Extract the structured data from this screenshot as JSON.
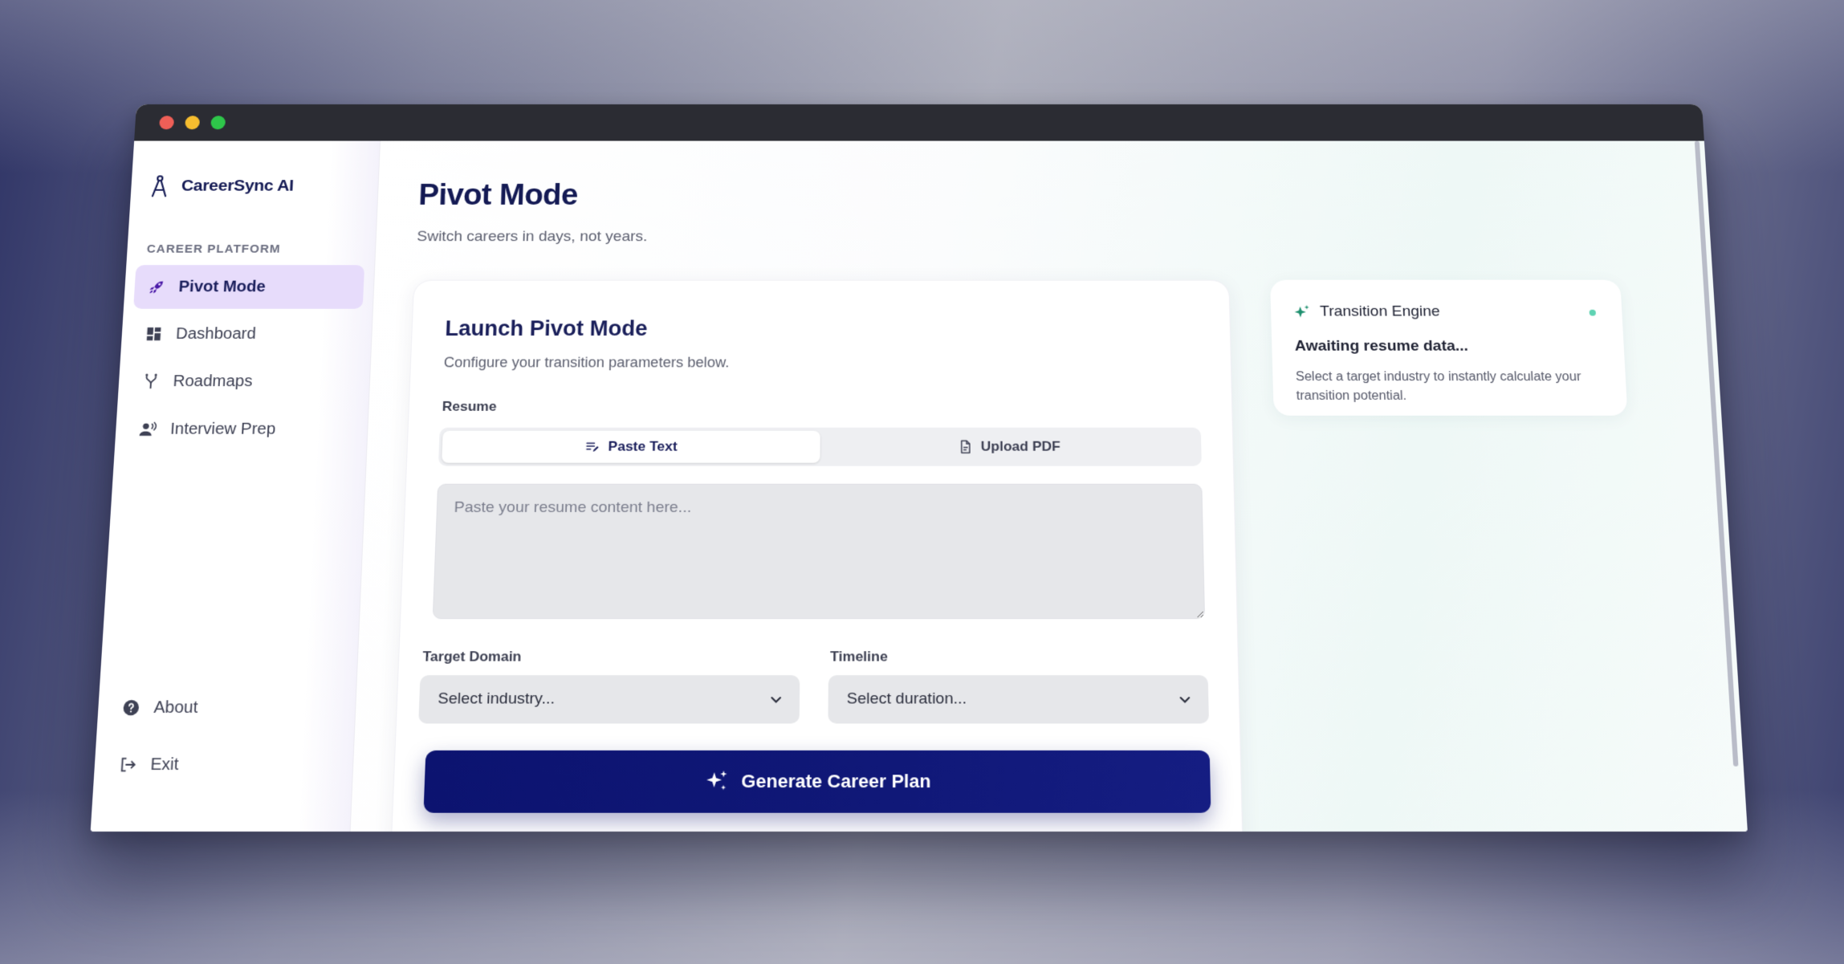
{
  "app": {
    "name": "CareerSync AI",
    "section_label": "CAREER PLATFORM"
  },
  "sidebar": {
    "items": [
      {
        "label": "Pivot Mode",
        "icon": "rocket-icon",
        "active": true
      },
      {
        "label": "Dashboard",
        "icon": "dashboard-icon",
        "active": false
      },
      {
        "label": "Roadmaps",
        "icon": "fork-icon",
        "active": false
      },
      {
        "label": "Interview Prep",
        "icon": "speaking-person-icon",
        "active": false
      }
    ],
    "bottom_items": [
      {
        "label": "About",
        "icon": "help-circle-icon"
      },
      {
        "label": "Exit",
        "icon": "logout-icon"
      }
    ]
  },
  "page": {
    "title": "Pivot Mode",
    "subtitle": "Switch careers in days, not years."
  },
  "form": {
    "title": "Launch Pivot Mode",
    "subtitle": "Configure your transition parameters below.",
    "resume_label": "Resume",
    "tabs": [
      {
        "label": "Paste Text",
        "icon": "text-edit-icon",
        "active": true
      },
      {
        "label": "Upload PDF",
        "icon": "file-icon",
        "active": false
      }
    ],
    "resume_placeholder": "Paste your resume content here...",
    "target_domain_label": "Target Domain",
    "target_domain_value": "Select industry...",
    "timeline_label": "Timeline",
    "timeline_value": "Select duration...",
    "generate_label": "Generate Career Plan"
  },
  "engine": {
    "title": "Transition Engine",
    "status": "Awaiting resume data...",
    "description": "Select a target industry to instantly calculate your transition potential."
  },
  "colors": {
    "brand_navy": "#141a54",
    "active_nav_bg": "#e7dcfb",
    "button_bg": "#0c1370",
    "status_dot": "#5fd3b3",
    "sparkle_green": "#1d8f6e"
  }
}
